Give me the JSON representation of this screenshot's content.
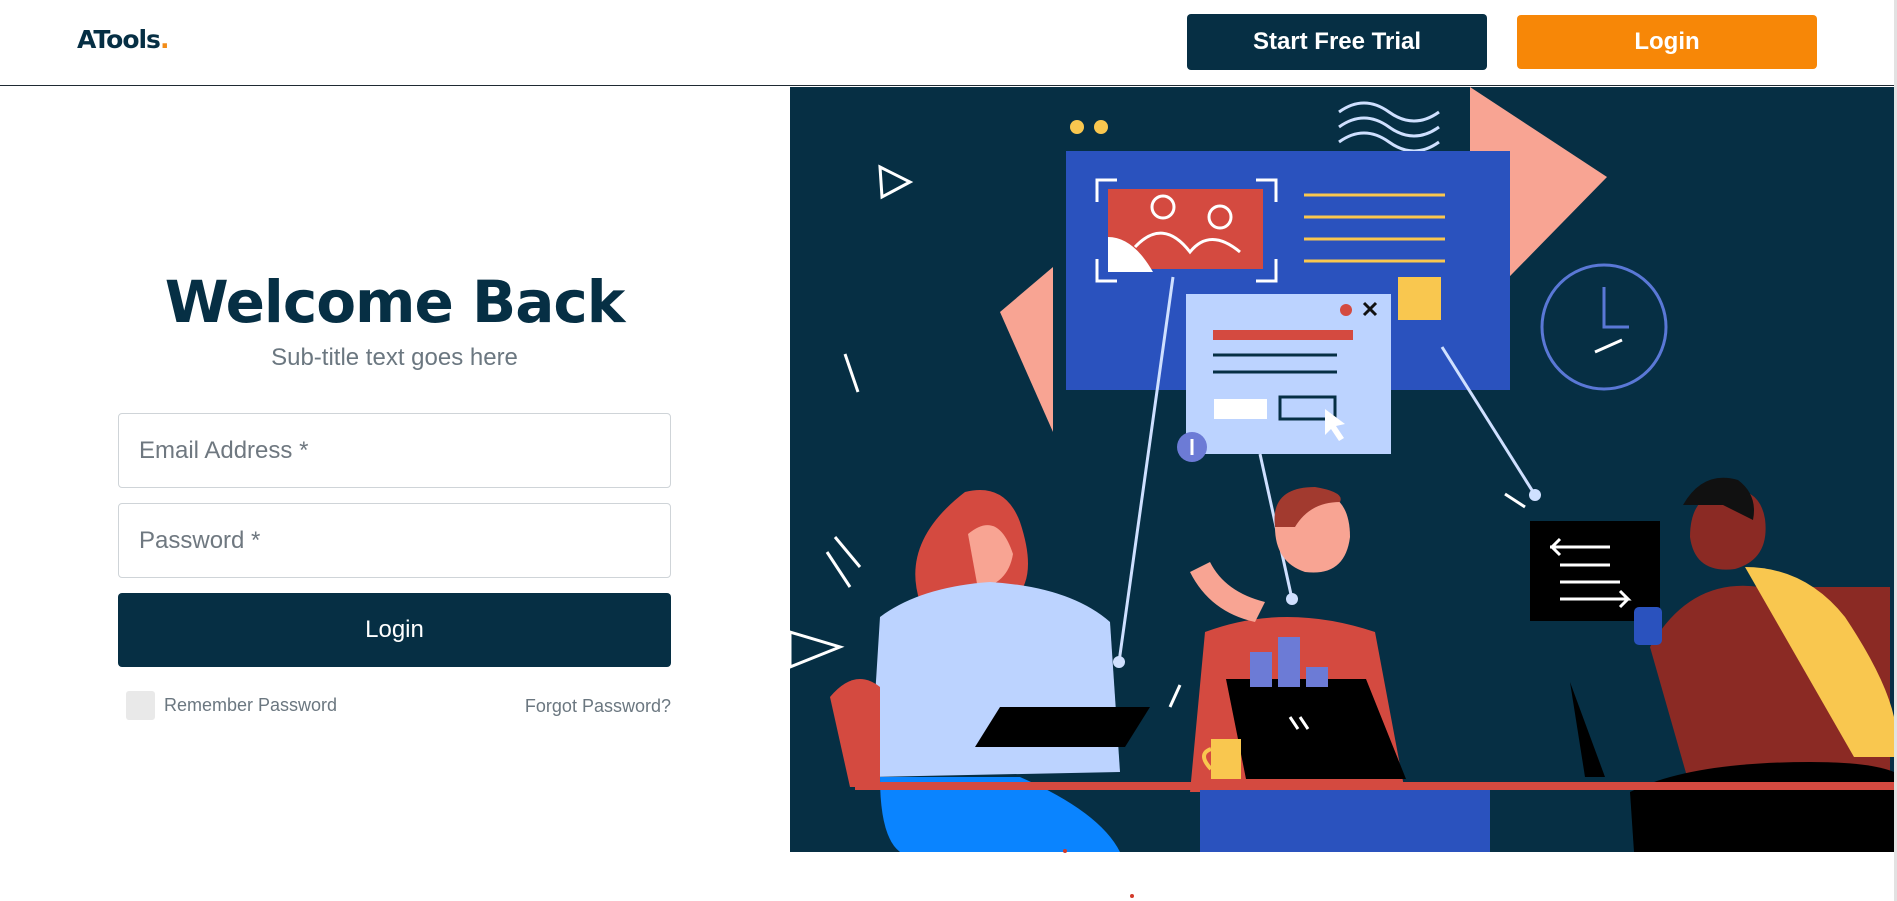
{
  "header": {
    "logo_text": "ATools",
    "logo_dot": ".",
    "trial_label": "Start Free Trial",
    "login_label": "Login"
  },
  "form": {
    "title": "Welcome Back",
    "subtitle": "Sub-title text goes here",
    "email_placeholder": "Email Address *",
    "email_value": "",
    "password_placeholder": "Password *",
    "password_value": "",
    "submit_label": "Login",
    "remember_label": "Remember Password",
    "remember_checked": false,
    "forgot_label": "Forgot Password?"
  },
  "colors": {
    "brand_navy": "#062f44",
    "accent_orange": "#f78707",
    "illustration_bg": "#062f44",
    "panel_blue": "#2a52be",
    "salmon": "#f8a493",
    "red": "#d44a40",
    "yellow": "#f9c74f"
  },
  "illustration": {
    "description_icons": [
      "picture-card-icon",
      "dialog-window-icon",
      "clock-icon",
      "code-window-icon",
      "laptop-icon",
      "mug-icon"
    ]
  }
}
